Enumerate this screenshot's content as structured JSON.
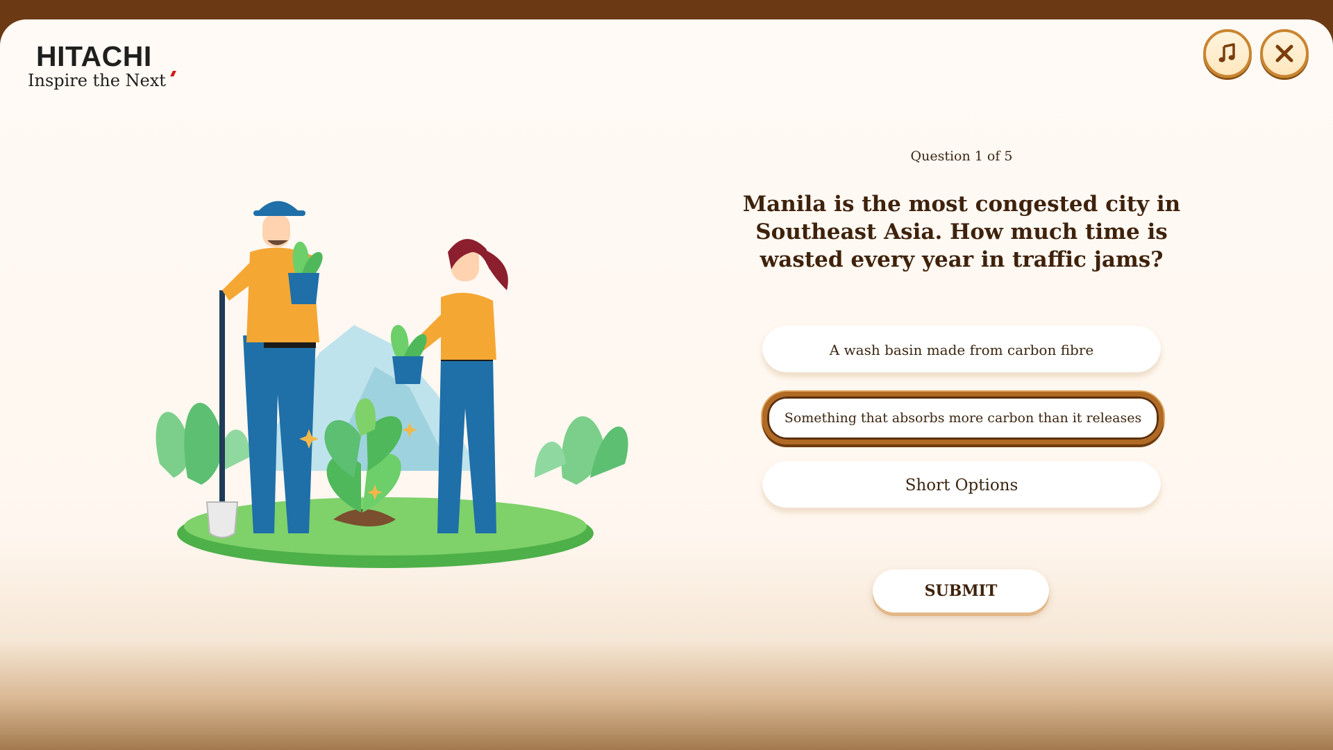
{
  "brand": {
    "name": "HITACHI",
    "tagline": "Inspire the Next"
  },
  "controls": {
    "music_icon": "music-note-icon",
    "close_icon": "close-icon"
  },
  "quiz": {
    "progress": "Question 1 of 5",
    "question": "Manila is the most congested city in Southeast Asia. How much time is wasted every year in traffic jams?",
    "options": [
      {
        "label": "A wash basin made from carbon fibre",
        "selected": false
      },
      {
        "label": "Something that absorbs more carbon than it releases",
        "selected": true
      },
      {
        "label": "Short Options",
        "selected": false
      }
    ],
    "submit_label": "SUBMIT"
  },
  "colors": {
    "accent": "#b06a24",
    "text": "#3f220c",
    "frame": "#6b3a14"
  }
}
